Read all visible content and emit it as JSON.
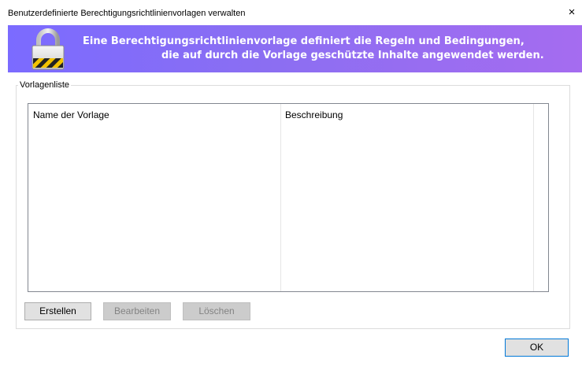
{
  "window": {
    "title": "Benutzerdefinierte Berechtigungsrichtlinienvorlagen verwalten",
    "close_glyph": "×"
  },
  "banner": {
    "line1": "Eine Berechtigungsrichtlinienvorlage definiert die Regeln und Bedingungen,",
    "line2": "die auf durch die Vorlage geschützte Inhalte angewendet werden.",
    "icon": "padlock-icon",
    "gradient": [
      "#7b6bff",
      "#a56cf0"
    ]
  },
  "template_list": {
    "group_label": "Vorlagenliste",
    "columns": [
      "Name der Vorlage",
      "Beschreibung"
    ],
    "rows": []
  },
  "buttons": {
    "create": "Erstellen",
    "edit": "Bearbeiten",
    "delete": "Löschen",
    "ok": "OK"
  }
}
